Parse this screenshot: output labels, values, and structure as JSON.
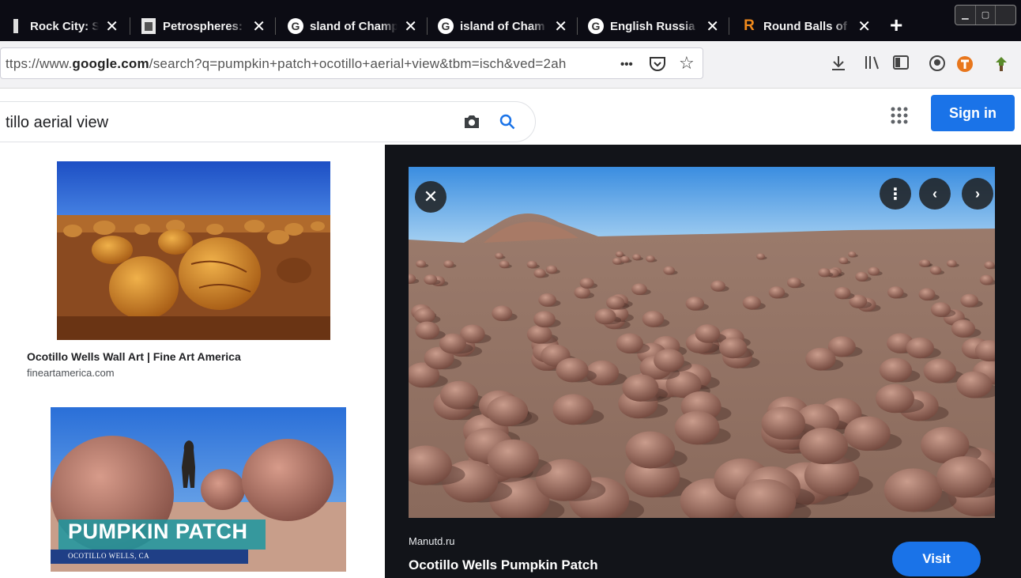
{
  "browser": {
    "tabs": [
      {
        "label": "Rock City: Sand",
        "favicon": "page-icon"
      },
      {
        "label": "Petrospheres: C",
        "favicon": "document-icon"
      },
      {
        "label": "sland of Champ",
        "favicon": "google-icon"
      },
      {
        "label": "island of Cham",
        "favicon": "google-icon"
      },
      {
        "label": "English Russia N",
        "favicon": "google-icon"
      },
      {
        "label": "Round Balls of C",
        "favicon": "r-icon"
      }
    ],
    "url_prefix": "ttps://www.",
    "url_domain": "google.com",
    "url_rest": "/search?q=pumpkin+patch+ocotillo+aerial+view&tbm=isch&ved=2ah",
    "url_menu_glyph": "•••"
  },
  "search": {
    "query": "tillo aerial view",
    "signin_label": "Sign in"
  },
  "results": [
    {
      "caption": "Ocotillo Wells Wall Art | Fine Art America",
      "source": "fineartamerica.com"
    },
    {
      "overlay_title": "PUMPKIN PATCH",
      "overlay_subtitle": "OCOTILLO WELLS, CA"
    }
  ],
  "preview": {
    "site": "Manutd.ru",
    "title": "Ocotillo Wells Pumpkin Patch",
    "visit_label": "Visit"
  },
  "colors": {
    "accent": "#1a73e8",
    "tabbar": "#0c0c14",
    "panel": "#121419"
  }
}
